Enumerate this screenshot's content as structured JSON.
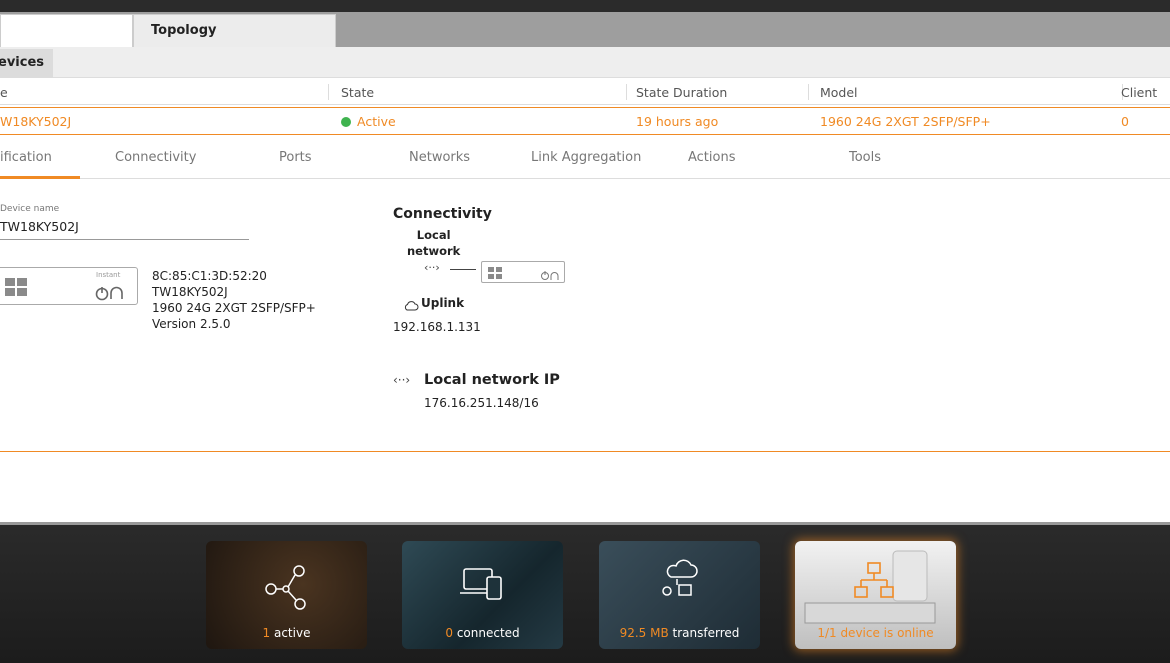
{
  "tabs": {
    "topology": "Topology"
  },
  "subtabs": {
    "devices": "evices"
  },
  "table": {
    "headers": {
      "name": "e",
      "state": "State",
      "state_duration": "State Duration",
      "model": "Model",
      "clients": "Client"
    },
    "row": {
      "name": "W18KY502J",
      "state": "Active",
      "state_duration": "19 hours ago",
      "model": "1960 24G 2XGT 2SFP/SFP+",
      "clients": "0"
    }
  },
  "detail_tabs": {
    "identification": "ification",
    "connectivity": "Connectivity",
    "ports": "Ports",
    "networks": "Networks",
    "link_aggregation": "Link Aggregation",
    "actions": "Actions",
    "tools": "Tools"
  },
  "identification": {
    "device_name_label": "Device name",
    "device_name_value": "TW18KY502J",
    "mac": "8C:85:C1:3D:52:20",
    "serial": "TW18KY502J",
    "model": "1960 24G 2XGT 2SFP/SFP+",
    "version": "Version 2.5.0",
    "box_brand_small": "Instant",
    "box_brand": "On"
  },
  "connectivity": {
    "title": "Connectivity",
    "local_network_line1": "Local",
    "local_network_line2": "network",
    "link_symbol": "‹··›",
    "uplink_label": "Uplink",
    "uplink_ip": "192.168.1.131",
    "local_network_ip_label": "Local network IP",
    "local_network_ip_value": "176.16.251.148/16"
  },
  "cards": [
    {
      "number": "1",
      "text": "active",
      "icon": "network-nodes-icon"
    },
    {
      "number": "0",
      "text": "connected",
      "icon": "devices-icon"
    },
    {
      "number": "92.5 MB",
      "text": "transferred",
      "icon": "cloud-transfer-icon"
    },
    {
      "number": "",
      "text": "1/1 device is online",
      "icon": "topology-icon"
    }
  ],
  "colors": {
    "accent": "#f08a24",
    "active_dot": "#3fb34f"
  }
}
